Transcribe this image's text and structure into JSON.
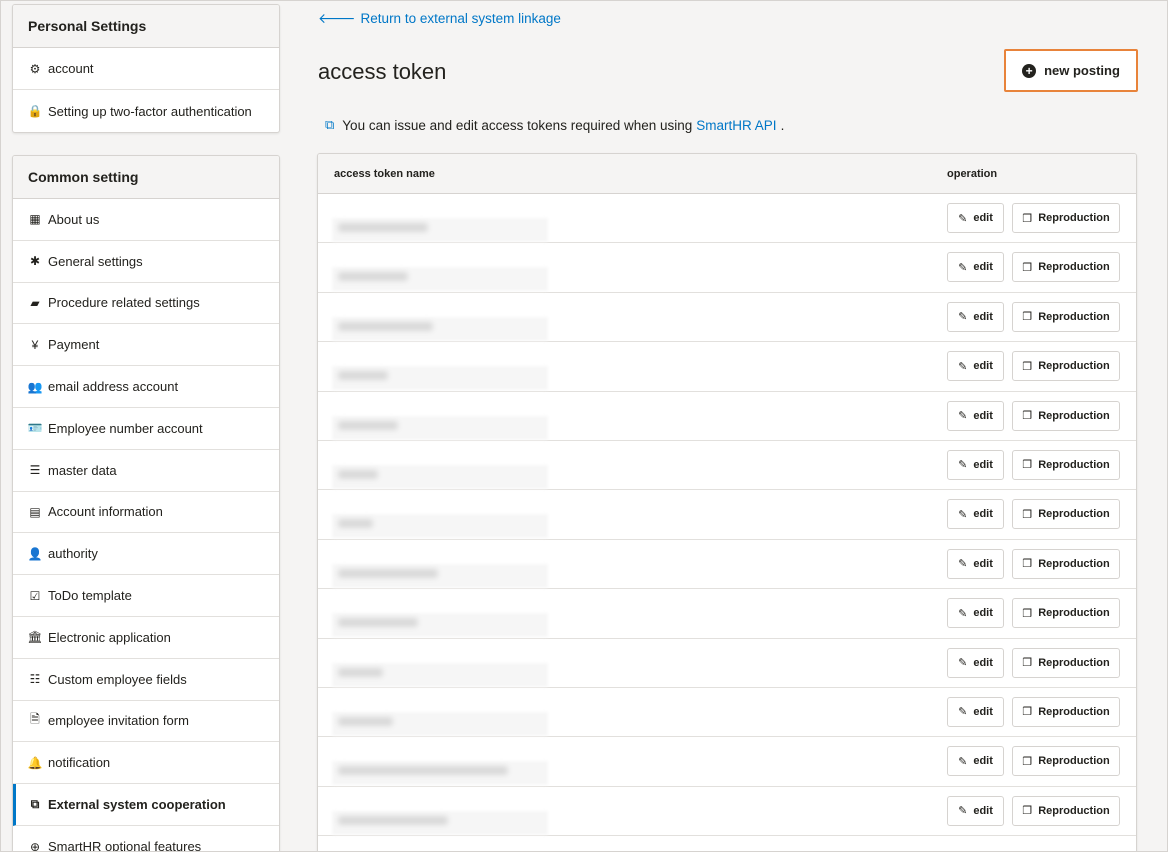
{
  "sidebar": {
    "personal": {
      "title": "Personal Settings",
      "items": [
        {
          "label": "account",
          "icon": "gear-icon",
          "glyph": "⚙"
        },
        {
          "label": "Setting up two-factor authentication",
          "icon": "lock-icon",
          "glyph": "🔒"
        }
      ]
    },
    "common": {
      "title": "Common setting",
      "items": [
        {
          "label": "About us",
          "icon": "building-icon",
          "glyph": "▦"
        },
        {
          "label": "General settings",
          "icon": "asterisk-icon",
          "glyph": "✱"
        },
        {
          "label": "Procedure related settings",
          "icon": "book-icon",
          "glyph": "▰"
        },
        {
          "label": "Payment",
          "icon": "yen-icon",
          "glyph": "¥"
        },
        {
          "label": "email address account",
          "icon": "users-icon",
          "glyph": "👥"
        },
        {
          "label": "Employee number account",
          "icon": "id-card-icon",
          "glyph": "🪪"
        },
        {
          "label": "master data",
          "icon": "database-icon",
          "glyph": "☰"
        },
        {
          "label": "Account information",
          "icon": "list-alt-icon",
          "glyph": "▤"
        },
        {
          "label": "authority",
          "icon": "user-check-icon",
          "glyph": "👤"
        },
        {
          "label": "ToDo template",
          "icon": "checkbox-icon",
          "glyph": "☑"
        },
        {
          "label": "Electronic application",
          "icon": "institution-icon",
          "glyph": "🏛"
        },
        {
          "label": "Custom employee fields",
          "icon": "list-icon",
          "glyph": "☷"
        },
        {
          "label": "employee invitation form",
          "icon": "document-icon",
          "glyph": "🗎"
        },
        {
          "label": "notification",
          "icon": "bell-icon",
          "glyph": "🔔"
        },
        {
          "label": "External system cooperation",
          "icon": "cubes-icon",
          "glyph": "⧉",
          "active": true
        },
        {
          "label": "SmartHR optional features",
          "icon": "plus-circle-icon",
          "glyph": "⊕"
        }
      ]
    }
  },
  "main": {
    "back_link": "Return to external system linkage",
    "title": "access token",
    "new_button": "new posting",
    "info_prefix": "You can issue and edit access tokens required when using",
    "info_link": "SmartHR API",
    "info_suffix": ".",
    "table": {
      "col_name": "access token name",
      "col_operation": "operation",
      "edit_label": "edit",
      "repro_label": "Reproduction",
      "row_count": 13
    }
  },
  "colors": {
    "accent": "#0077c7",
    "highlight": "#e8833a"
  }
}
